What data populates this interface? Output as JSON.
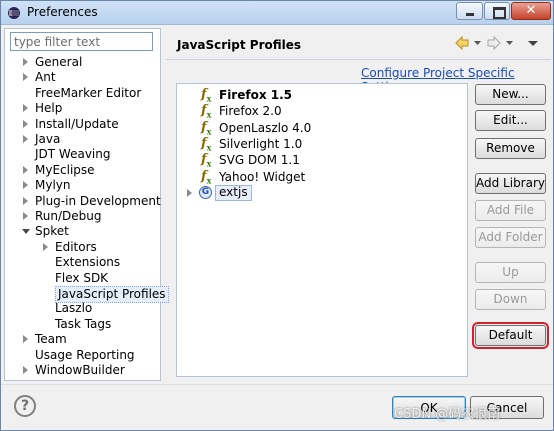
{
  "window": {
    "title": "Preferences",
    "close_label": "✕"
  },
  "left": {
    "filter_placeholder": "type filter text",
    "tree": [
      {
        "label": "General",
        "expander": "closed"
      },
      {
        "label": "Ant",
        "expander": "closed"
      },
      {
        "label": "FreeMarker Editor",
        "expander": "none"
      },
      {
        "label": "Help",
        "expander": "closed"
      },
      {
        "label": "Install/Update",
        "expander": "closed"
      },
      {
        "label": "Java",
        "expander": "closed"
      },
      {
        "label": "JDT Weaving",
        "expander": "none"
      },
      {
        "label": "MyEclipse",
        "expander": "closed"
      },
      {
        "label": "Mylyn",
        "expander": "closed"
      },
      {
        "label": "Plug-in Development",
        "expander": "closed"
      },
      {
        "label": "Run/Debug",
        "expander": "closed"
      },
      {
        "label": "Spket",
        "expander": "open"
      },
      {
        "label": "Editors",
        "expander": "closed",
        "child": true
      },
      {
        "label": "Extensions",
        "expander": "none",
        "child": true
      },
      {
        "label": "Flex SDK",
        "expander": "none",
        "child": true
      },
      {
        "label": "JavaScript Profiles",
        "expander": "none",
        "child": true,
        "selected": true
      },
      {
        "label": "Laszlo",
        "expander": "none",
        "child": true
      },
      {
        "label": "Task Tags",
        "expander": "none",
        "child": true
      },
      {
        "label": "Team",
        "expander": "closed"
      },
      {
        "label": "Usage Reporting",
        "expander": "none"
      },
      {
        "label": "WindowBuilder",
        "expander": "closed"
      }
    ]
  },
  "right": {
    "title": "JavaScript Profiles",
    "config_link": "Configure Project Specific Settings...",
    "profiles": [
      {
        "label": "Firefox 1.5",
        "default": true
      },
      {
        "label": "Firefox 2.0"
      },
      {
        "label": "OpenLaszlo 4.0"
      },
      {
        "label": "Silverlight 1.0"
      },
      {
        "label": "SVG DOM 1.1"
      },
      {
        "label": "Yahoo! Widget"
      }
    ],
    "library": {
      "label": "extjs",
      "icon_letter": "G"
    },
    "buttons": {
      "new": "New...",
      "edit": "Edit...",
      "remove": "Remove",
      "add_library": "Add Library",
      "add_file": "Add File",
      "add_folder": "Add Folder",
      "up": "Up",
      "down": "Down",
      "default": "Default"
    }
  },
  "footer": {
    "help_symbol": "?",
    "ok": "OK",
    "cancel": "Cancel",
    "watermark": "CSDN @码农很南"
  },
  "colors": {
    "accent": "#1b4cb5",
    "highlight_border": "#d0222e"
  }
}
